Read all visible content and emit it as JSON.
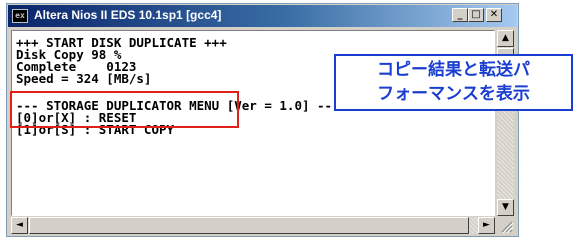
{
  "window": {
    "title": "Altera Nios II EDS 10.1sp1 [gcc4]",
    "app_icon_text": "ex",
    "buttons": {
      "minimize": "_",
      "maximize": "□",
      "close": "✕"
    }
  },
  "console": {
    "lines": [
      "+++ START DISK DUPLICATE +++",
      "Disk Copy 98 %",
      "Complete    0123",
      "Speed = 324 [MB/s]",
      "",
      "--- STORAGE DUPLICATOR MENU [Ver = 1.0] ---",
      "[0]or[X] : RESET",
      "[1]or[S] : START COPY"
    ]
  },
  "scroll": {
    "up": "▲",
    "down": "▼",
    "left": "◄",
    "right": "►"
  },
  "annotation": {
    "line1": "コピー結果と転送パ",
    "line2": "フォーマンスを表示",
    "border_color": "#1a3fd0",
    "highlight_color": "#e0201a"
  }
}
